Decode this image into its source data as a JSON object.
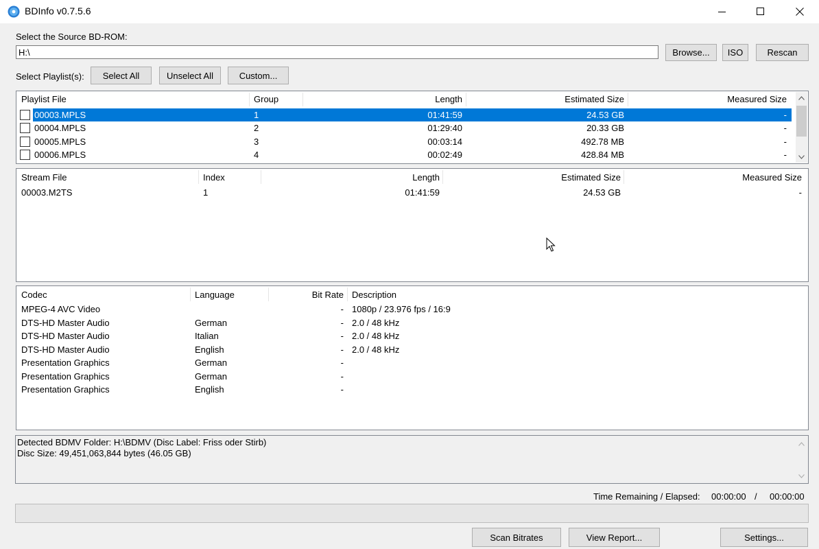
{
  "window": {
    "title": "BDInfo v0.7.5.6",
    "icon": "bluray-disc-icon"
  },
  "source": {
    "label": "Select the Source BD-ROM:",
    "path_value": "H:\\",
    "browse_label": "Browse...",
    "iso_label": "ISO",
    "rescan_label": "Rescan"
  },
  "playlist_controls": {
    "label": "Select Playlist(s):",
    "select_all": "Select All",
    "unselect_all": "Unselect All",
    "custom": "Custom..."
  },
  "playlists": {
    "headers": [
      "Playlist File",
      "Group",
      "Length",
      "Estimated Size",
      "Measured Size"
    ],
    "rows": [
      {
        "file": "00003.MPLS",
        "group": "1",
        "length": "01:41:59",
        "est": "24.53 GB",
        "measured": "-",
        "selected": true
      },
      {
        "file": "00004.MPLS",
        "group": "2",
        "length": "01:29:40",
        "est": "20.33 GB",
        "measured": "-",
        "selected": false
      },
      {
        "file": "00005.MPLS",
        "group": "3",
        "length": "00:03:14",
        "est": "492.78 MB",
        "measured": "-",
        "selected": false
      },
      {
        "file": "00006.MPLS",
        "group": "4",
        "length": "00:02:49",
        "est": "428.84 MB",
        "measured": "-",
        "selected": false
      }
    ]
  },
  "streams": {
    "headers": [
      "Stream File",
      "Index",
      "Length",
      "Estimated Size",
      "Measured Size"
    ],
    "rows": [
      {
        "file": "00003.M2TS",
        "index": "1",
        "length": "01:41:59",
        "est": "24.53 GB",
        "measured": "-"
      }
    ]
  },
  "codecs": {
    "headers": [
      "Codec",
      "Language",
      "Bit Rate",
      "Description"
    ],
    "rows": [
      {
        "codec": "MPEG-4 AVC Video",
        "language": "",
        "bitrate": "-",
        "description": "1080p / 23.976 fps / 16:9"
      },
      {
        "codec": "DTS-HD Master Audio",
        "language": "German",
        "bitrate": "-",
        "description": "2.0 / 48 kHz"
      },
      {
        "codec": "DTS-HD Master Audio",
        "language": "Italian",
        "bitrate": "-",
        "description": "2.0 / 48 kHz"
      },
      {
        "codec": "DTS-HD Master Audio",
        "language": "English",
        "bitrate": "-",
        "description": "2.0 / 48 kHz"
      },
      {
        "codec": "Presentation Graphics",
        "language": "German",
        "bitrate": "-",
        "description": ""
      },
      {
        "codec": "Presentation Graphics",
        "language": "German",
        "bitrate": "-",
        "description": ""
      },
      {
        "codec": "Presentation Graphics",
        "language": "English",
        "bitrate": "-",
        "description": ""
      }
    ]
  },
  "log": {
    "lines": [
      "Detected BDMV Folder: H:\\BDMV (Disc Label: Friss oder Stirb)",
      "Disc Size: 49,451,063,844 bytes (46.05 GB)"
    ]
  },
  "time": {
    "label": "Time Remaining / Elapsed:",
    "remaining": "00:00:00",
    "separator": "/",
    "elapsed": "00:00:00"
  },
  "progress": 0,
  "bottom_buttons": {
    "scan_bitrates": "Scan Bitrates",
    "view_report": "View Report...",
    "settings": "Settings..."
  },
  "colors": {
    "selection": "#0078d7",
    "window_bg": "#f0f0f0"
  }
}
